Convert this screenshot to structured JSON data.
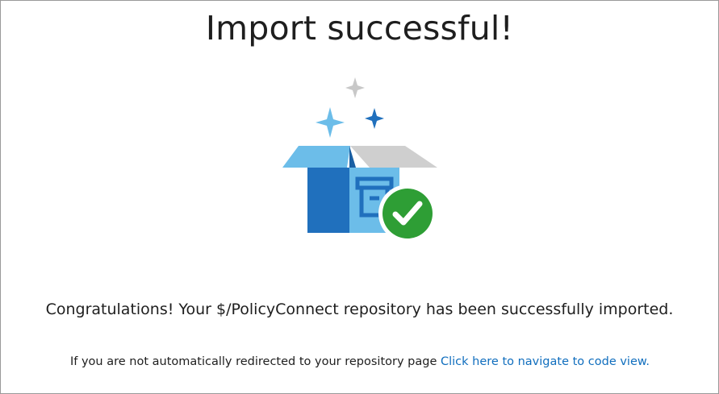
{
  "page": {
    "title": "Import successful!",
    "message": "Congratulations! Your $/PolicyConnect repository has been successfully imported.",
    "redirect_text": "If you are not automatically redirected to your repository page ",
    "redirect_link_label": "Click here to navigate to code view."
  },
  "icons": {
    "illustration": "open-box-with-sparkles-icon",
    "success": "check-circle-icon"
  },
  "colors": {
    "link": "#106ebe",
    "success_green": "#2e9e35",
    "box_dark_blue": "#2070bd",
    "box_light_blue": "#6cbde9",
    "lid_gray": "#cfcfcf",
    "sparkle_gray": "#c8c8c8"
  }
}
